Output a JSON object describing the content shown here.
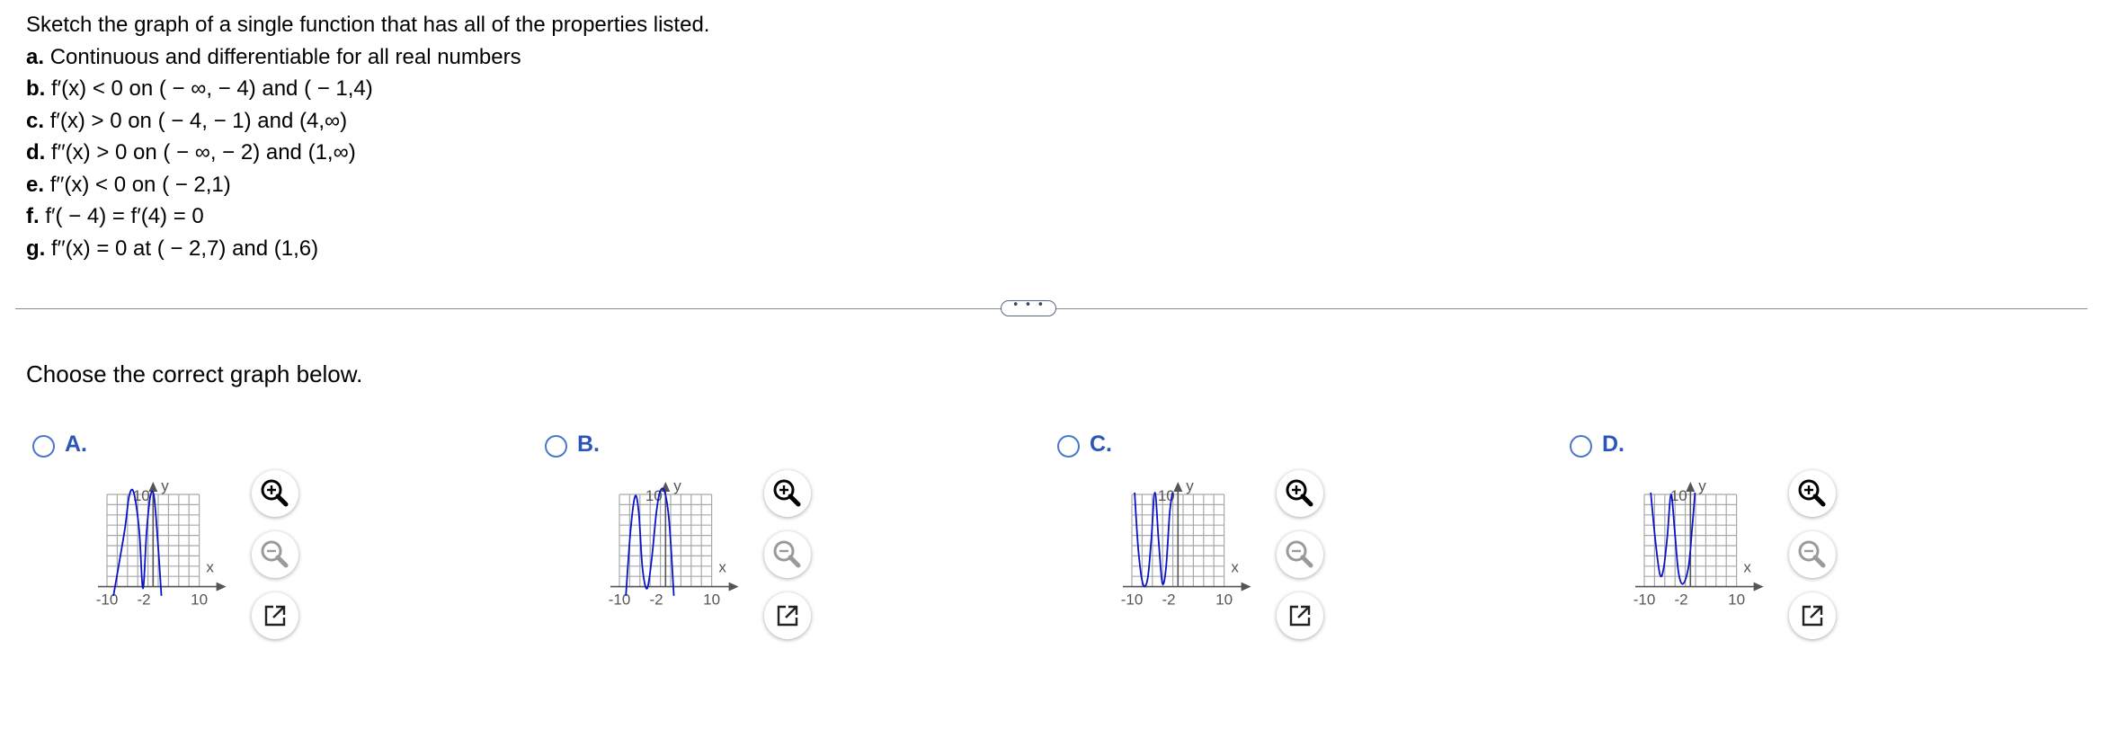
{
  "question": {
    "intro": "Sketch the graph of a single function that has all of the properties listed.",
    "properties": [
      {
        "letter": "a.",
        "text": "Continuous and differentiable for all real numbers"
      },
      {
        "letter": "b.",
        "text": "f′(x) < 0 on ( − ∞, − 4) and ( − 1,4)"
      },
      {
        "letter": "c.",
        "text": "f′(x) > 0 on ( − 4, − 1) and (4,∞)"
      },
      {
        "letter": "d.",
        "text": "f′′(x) > 0 on ( − ∞, − 2) and (1,∞)"
      },
      {
        "letter": "e.",
        "text": "f′′(x) < 0 on ( − 2,1)"
      },
      {
        "letter": "f.",
        "text": "f′( − 4) = f′(4) = 0"
      },
      {
        "letter": "g.",
        "text": "f′′(x) = 0 at ( − 2,7) and (1,6)"
      }
    ]
  },
  "more_button": "• • •",
  "prompt": "Choose the correct graph below.",
  "options": [
    {
      "label": "A.",
      "graph": {
        "axis_y": "y",
        "axis_x": "x",
        "tick_left": "-10",
        "tick_mid": "-2",
        "tick_right": "10",
        "tick_top": "10"
      }
    },
    {
      "label": "B.",
      "graph": {
        "axis_y": "y",
        "axis_x": "x",
        "tick_left": "-10",
        "tick_mid": "-2",
        "tick_right": "10",
        "tick_top": "10"
      }
    },
    {
      "label": "C.",
      "graph": {
        "axis_y": "y",
        "axis_x": "x",
        "tick_left": "-10",
        "tick_mid": "-2",
        "tick_right": "10",
        "tick_top": "10"
      }
    },
    {
      "label": "D.",
      "graph": {
        "axis_y": "y",
        "axis_x": "x",
        "tick_left": "-10",
        "tick_mid": "-2",
        "tick_right": "10",
        "tick_top": "10"
      }
    }
  ],
  "colors": {
    "curve": "#0a12c8",
    "grid": "#a8a8a8",
    "axis": "#555555",
    "option_label": "#2b56b8",
    "radio": "#4a78c8"
  },
  "icons": {
    "zoom_in": "zoom-in-icon",
    "zoom_out": "zoom-out-icon",
    "popout": "popout-icon"
  }
}
